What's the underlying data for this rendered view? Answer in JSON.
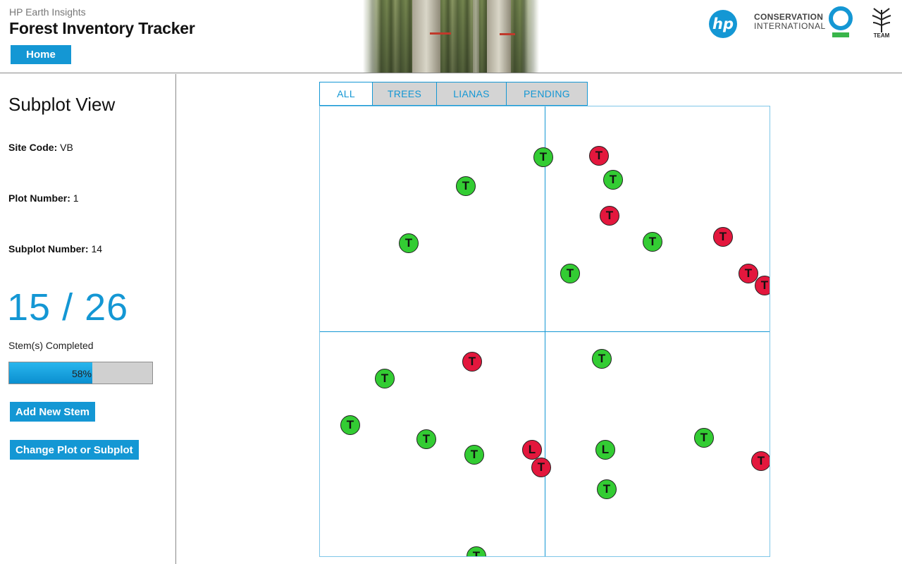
{
  "header": {
    "subtitle": "HP Earth Insights",
    "title": "Forest Inventory Tracker",
    "home_label": "Home",
    "hp_logo_text": "hp",
    "ci_line1": "CONSERVATION",
    "ci_line2": "INTERNATIONAL",
    "team_text": "TEAM"
  },
  "sidebar": {
    "title": "Subplot View",
    "site_code_label": "Site Code:",
    "site_code_value": "VB",
    "plot_number_label": "Plot Number:",
    "plot_number_value": "1",
    "subplot_number_label": "Subplot Number:",
    "subplot_number_value": "14",
    "count_text": "15 / 26",
    "count_label": "Stem(s) Completed",
    "progress_fraction": 0.58,
    "progress_text": "58%",
    "add_stem_label": "Add New Stem",
    "change_plot_label": "Change Plot or Subplot"
  },
  "tabs": [
    {
      "label": "ALL",
      "active": true
    },
    {
      "label": "TREES",
      "active": false
    },
    {
      "label": "LIANAS",
      "active": false
    },
    {
      "label": "PENDING",
      "active": false
    }
  ],
  "colors": {
    "accent": "#1497d4",
    "stem_completed": "#33cc33",
    "stem_pending": "#e3173d"
  },
  "stems": [
    {
      "label": "T",
      "status": "completed"
    },
    {
      "label": "T",
      "status": "pending"
    },
    {
      "label": "T",
      "status": "completed"
    },
    {
      "label": "T",
      "status": "completed"
    },
    {
      "label": "T",
      "status": "pending"
    },
    {
      "label": "T",
      "status": "completed"
    },
    {
      "label": "T",
      "status": "pending"
    },
    {
      "label": "T",
      "status": "completed"
    },
    {
      "label": "T",
      "status": "completed"
    },
    {
      "label": "T",
      "status": "pending"
    },
    {
      "label": "T",
      "status": "pending"
    },
    {
      "label": "T",
      "status": "completed"
    },
    {
      "label": "T",
      "status": "pending"
    },
    {
      "label": "T",
      "status": "completed"
    },
    {
      "label": "T",
      "status": "completed"
    },
    {
      "label": "T",
      "status": "completed"
    },
    {
      "label": "T",
      "status": "completed"
    },
    {
      "label": "L",
      "status": "pending"
    },
    {
      "label": "T",
      "status": "pending"
    },
    {
      "label": "L",
      "status": "completed"
    },
    {
      "label": "T",
      "status": "completed"
    },
    {
      "label": "T",
      "status": "pending"
    },
    {
      "label": "T",
      "status": "completed"
    },
    {
      "label": "T",
      "status": "completed"
    }
  ]
}
